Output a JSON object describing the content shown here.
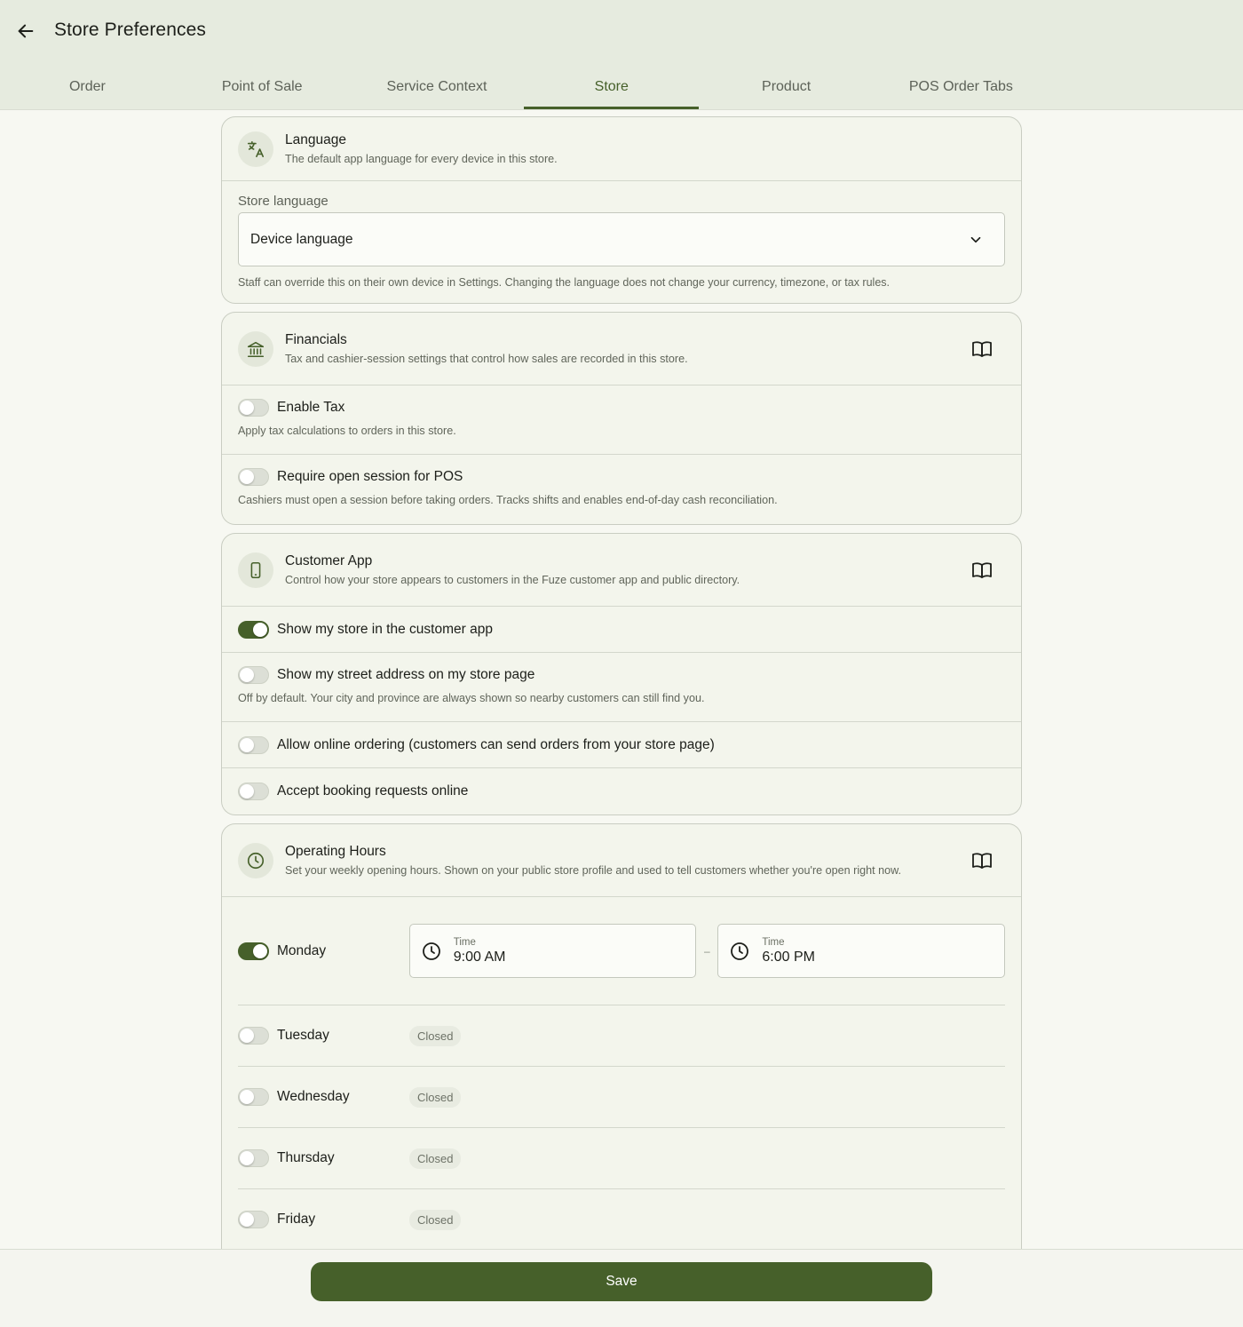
{
  "header": {
    "title": "Store Preferences",
    "tabs": [
      {
        "label": "Order"
      },
      {
        "label": "Point of Sale"
      },
      {
        "label": "Service Context"
      },
      {
        "label": "Store"
      },
      {
        "label": "Product"
      },
      {
        "label": "POS Order Tabs"
      }
    ],
    "active_tab": "Store"
  },
  "language": {
    "title": "Language",
    "subtitle": "The default app language for every device in this store.",
    "field_label": "Store language",
    "selected": "Device language",
    "helper": "Staff can override this on their own device in Settings. Changing the language does not change your currency, timezone, or tax rules.",
    "icon": "translate-icon"
  },
  "financials": {
    "title": "Financials",
    "subtitle": "Tax and cashier-session settings that control how sales are recorded in this store.",
    "icon": "bank-icon",
    "items": [
      {
        "label": "Enable Tax",
        "description": "Apply tax calculations to orders in this store.",
        "on": false
      },
      {
        "label": "Require open session for POS",
        "description": "Cashiers must open a session before taking orders. Tracks shifts and enables end-of-day cash reconciliation.",
        "on": false
      }
    ]
  },
  "customer_app": {
    "title": "Customer App",
    "subtitle": "Control how your store appears to customers in the Fuze customer app and public directory.",
    "icon": "phone-icon",
    "items": [
      {
        "label": "Show my store in the customer app",
        "on": true
      },
      {
        "label": "Show my street address on my store page",
        "description": "Off by default. Your city and province are always shown so nearby customers can still find you.",
        "on": false
      },
      {
        "label": "Allow online ordering (customers can send orders from your store page)",
        "on": false
      },
      {
        "label": "Accept booking requests online",
        "on": false
      }
    ]
  },
  "operating_hours": {
    "title": "Operating Hours",
    "subtitle": "Set your weekly opening hours. Shown on your public store profile and used to tell customers whether you're open right now.",
    "icon": "clock-icon",
    "time_caption": "Time",
    "dash": "–",
    "closed_label": "Closed",
    "days": [
      {
        "name": "Monday",
        "open": true,
        "start": "9:00 AM",
        "end": "6:00 PM"
      },
      {
        "name": "Tuesday",
        "open": false
      },
      {
        "name": "Wednesday",
        "open": false
      },
      {
        "name": "Thursday",
        "open": false
      },
      {
        "name": "Friday",
        "open": false
      }
    ]
  },
  "footer": {
    "save_label": "Save"
  },
  "colors": {
    "accent": "#46602a",
    "header_bg": "#e6ebdf",
    "page_bg": "#f7f8f2"
  }
}
